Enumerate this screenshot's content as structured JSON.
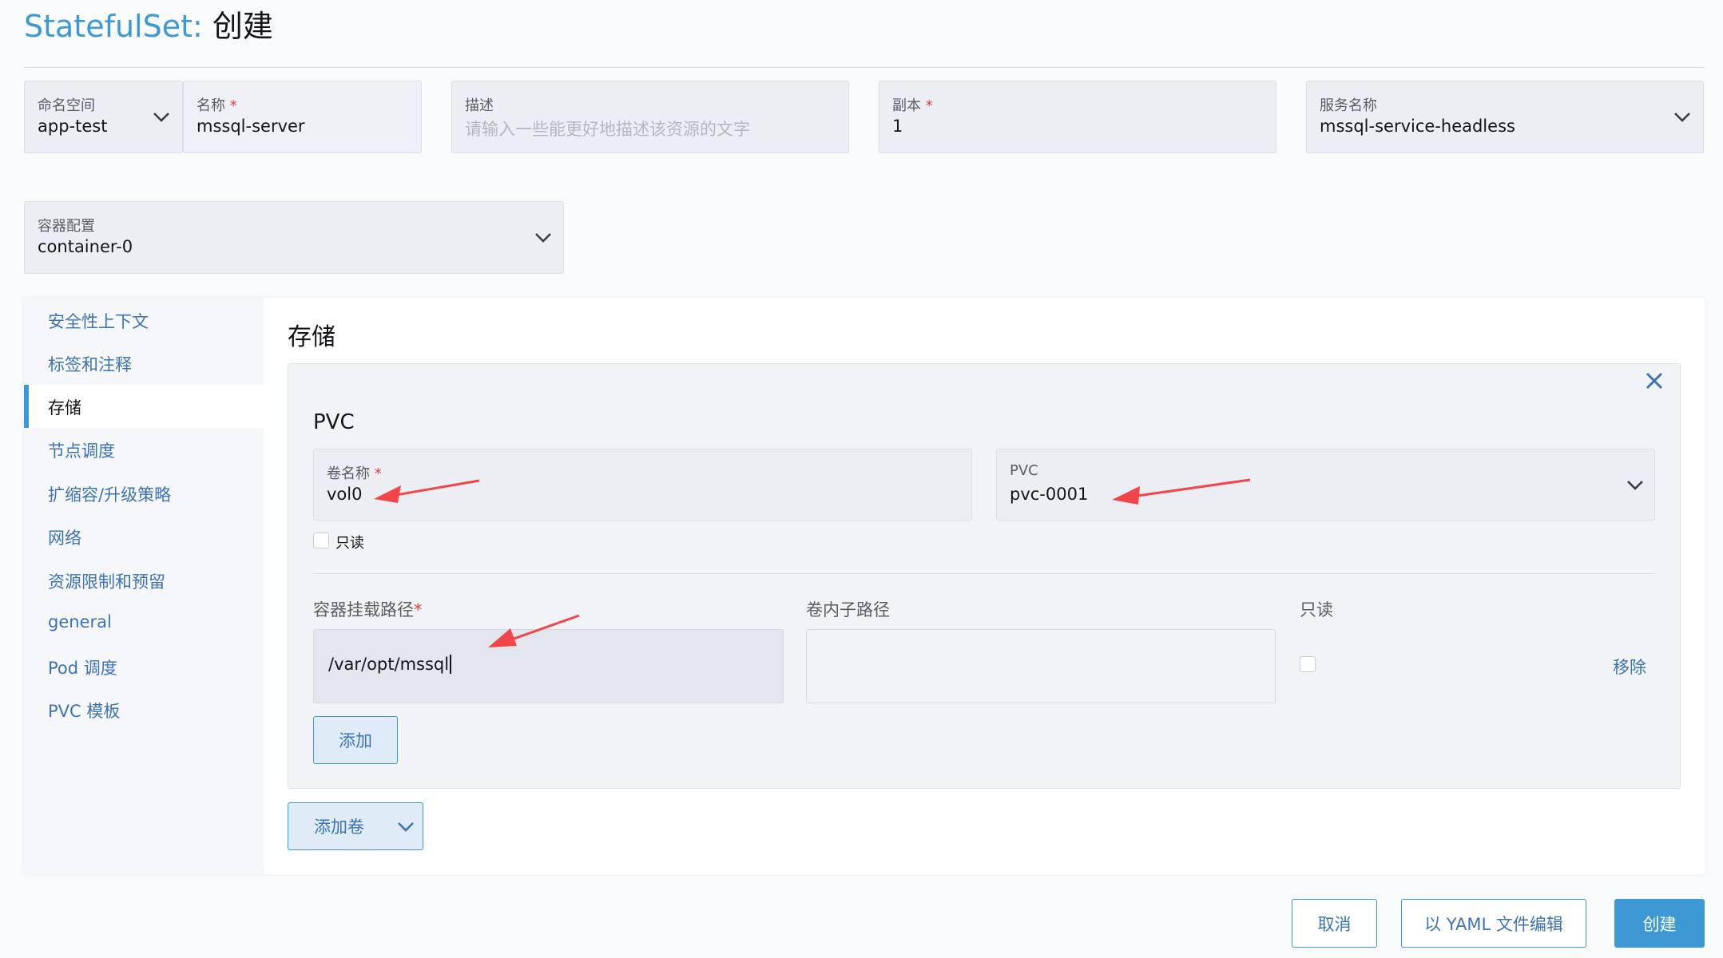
{
  "page": {
    "title_kind": "StatefulSet",
    "title_sep": ":",
    "title_action": "创建"
  },
  "top_fields": {
    "namespace": {
      "label": "命名空间",
      "value": "app-test"
    },
    "name": {
      "label": "名称",
      "required_mark": "*",
      "value": "mssql-server"
    },
    "description": {
      "label": "描述",
      "placeholder": "请输入一些能更好地描述该资源的文字"
    },
    "replicas": {
      "label": "副本",
      "required_mark": "*",
      "value": "1"
    },
    "service_name": {
      "label": "服务名称",
      "value": "mssql-service-headless"
    }
  },
  "container_config": {
    "label": "容器配置",
    "value": "container-0"
  },
  "sidebar": {
    "items": [
      {
        "label": "安全性上下文"
      },
      {
        "label": "标签和注释"
      },
      {
        "label": "存储",
        "active": true
      },
      {
        "label": "节点调度"
      },
      {
        "label": "扩缩容/升级策略"
      },
      {
        "label": "网络"
      },
      {
        "label": "资源限制和预留"
      },
      {
        "label": "general"
      },
      {
        "label": "Pod 调度"
      },
      {
        "label": "PVC 模板"
      }
    ]
  },
  "storage": {
    "section_title": "存储",
    "volume_card": {
      "title": "PVC",
      "volume_name": {
        "label": "卷名称",
        "required_mark": "*",
        "value": "vol0"
      },
      "pvc": {
        "label": "PVC",
        "value": "pvc-0001"
      },
      "readonly_label": "只读",
      "mount_headers": {
        "container_path": "容器挂载路径",
        "container_path_required": "*",
        "sub_path": "卷内子路径",
        "readonly": "只读"
      },
      "mount_row": {
        "container_path": "/var/opt/mssql",
        "sub_path": "",
        "remove_label": "移除"
      },
      "add_button": "添加"
    },
    "add_volume_button": "添加卷"
  },
  "footer": {
    "cancel": "取消",
    "edit_yaml": "以 YAML 文件编辑",
    "create": "创建"
  },
  "colors": {
    "accent": "#3d98d3",
    "link": "#3d73b0",
    "required": "#e0403b",
    "annotation_arrow": "#f0464b"
  }
}
